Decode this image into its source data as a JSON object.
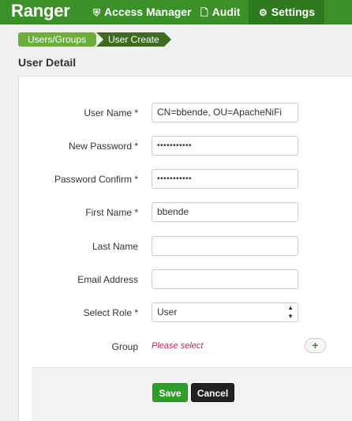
{
  "header": {
    "brand": "Ranger",
    "nav": [
      {
        "label": "Access Manager",
        "icon": "shield-icon"
      },
      {
        "label": "Audit",
        "icon": "file-icon"
      },
      {
        "label": "Settings",
        "icon": "gear-icon"
      }
    ],
    "accent_color": "#3c9028"
  },
  "breadcrumb": [
    "Users/Groups",
    "User Create"
  ],
  "page_title": "User Detail",
  "form": {
    "user_name": {
      "label": "User Name *",
      "value": "CN=bbende, OU=ApacheNiFi"
    },
    "new_password": {
      "label": "New Password *",
      "value": "•••••••••••"
    },
    "password_confirm": {
      "label": "Password Confirm *",
      "value": "•••••••••••"
    },
    "first_name": {
      "label": "First Name *",
      "value": "bbende"
    },
    "last_name": {
      "label": "Last Name",
      "value": ""
    },
    "email": {
      "label": "Email Address",
      "value": ""
    },
    "role": {
      "label": "Select Role *",
      "value": "User"
    },
    "group": {
      "label": "Group",
      "placeholder": "Please select"
    }
  },
  "actions": {
    "save": "Save",
    "cancel": "Cancel"
  }
}
